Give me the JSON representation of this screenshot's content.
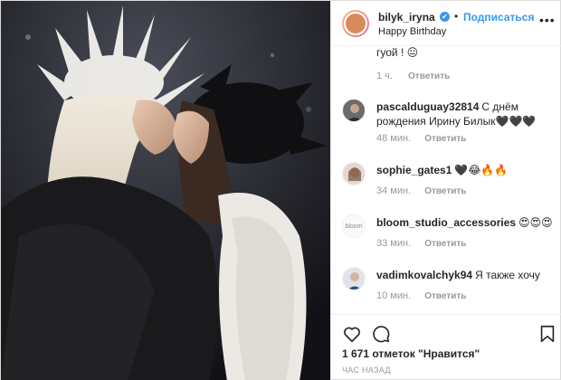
{
  "post": {
    "username": "bilyk_iryna",
    "verified_badge": "✔",
    "separator": "•",
    "follow_label": "Подписаться",
    "location": "Happy Birthday",
    "more_label": "•••"
  },
  "first_comment": {
    "text": "гуой ! 😐",
    "time": "1 ч.",
    "reply_label": "Ответить"
  },
  "comments": [
    {
      "username": "pascalduguay32814",
      "text": "С днём рождения Ирину Билык🖤🖤🖤",
      "time": "48 мин.",
      "reply_label": "Ответить"
    },
    {
      "username": "sophie_gates1",
      "text": "🖤😂🔥🔥",
      "time": "34 мин.",
      "reply_label": "Ответить"
    },
    {
      "username": "bloom_studio_accessories",
      "text": "😍😍😍",
      "time": "33 мин.",
      "reply_label": "Ответить"
    },
    {
      "username": "vadimkovalchyk94",
      "text": "Я также хочу",
      "time": "10 мин.",
      "reply_label": "Ответить"
    }
  ],
  "comment_like_icon": "heart-outline-icon",
  "bloom_avatar_text": "bloom",
  "actions": {
    "like_icon": "heart-icon",
    "comment_icon": "comment-icon",
    "bookmark_icon": "bookmark-icon"
  },
  "likes_text": "1 671 отметок \"Нравится\"",
  "posted_time": "ЧАС НАЗАД",
  "colors": {
    "accent": "#3897f0",
    "muted": "#999999",
    "text": "#262626"
  }
}
